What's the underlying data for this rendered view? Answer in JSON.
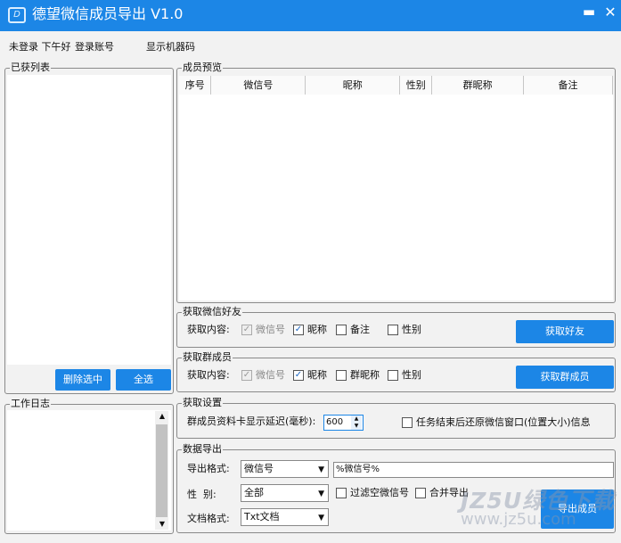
{
  "window": {
    "title": "德望微信成员导出 V1.0",
    "logo_text": "D",
    "minimize_glyph": "▬",
    "close_glyph": "✕",
    "accent_color": "#1c86e6"
  },
  "topbar": {
    "login_status": "未登录 下午好",
    "login_link": "登录账号",
    "machine_code_link": "显示机器码"
  },
  "acquired_list": {
    "legend": "已获列表",
    "delete_selected": "删除选中",
    "select_all": "全选"
  },
  "work_log": {
    "legend": "工作日志"
  },
  "member_preview": {
    "legend": "成员预览",
    "columns": [
      "序号",
      "微信号",
      "昵称",
      "性别",
      "群昵称",
      "备注"
    ]
  },
  "friends": {
    "legend": "获取微信好友",
    "content_label": "获取内容:",
    "options": [
      {
        "label": "微信号",
        "checked": true,
        "disabled": true
      },
      {
        "label": "昵称",
        "checked": true,
        "disabled": false
      },
      {
        "label": "备注",
        "checked": false,
        "disabled": false
      },
      {
        "label": "性别",
        "checked": false,
        "disabled": false
      }
    ],
    "button": "获取好友"
  },
  "group": {
    "legend": "获取群成员",
    "content_label": "获取内容:",
    "options": [
      {
        "label": "微信号",
        "checked": true,
        "disabled": true
      },
      {
        "label": "昵称",
        "checked": true,
        "disabled": false
      },
      {
        "label": "群昵称",
        "checked": false,
        "disabled": false
      },
      {
        "label": "性别",
        "checked": false,
        "disabled": false
      }
    ],
    "button": "获取群成员"
  },
  "settings": {
    "legend": "获取设置",
    "delay_label": "群成员资料卡显示延迟(毫秒):",
    "delay_value": "600",
    "restore_label": "任务结束后还原微信窗口(位置大小)信息",
    "restore_checked": false
  },
  "export": {
    "legend": "数据导出",
    "format_label": "导出格式:",
    "format_value": "微信号",
    "format_template": "%微信号%",
    "gender_label": "性  别:",
    "gender_value": "全部",
    "filter_empty_label": "过滤空微信号",
    "merge_label": "合并导出",
    "doc_format_label": "文档格式:",
    "doc_format_value": "Txt文档",
    "export_button": "导出成员"
  },
  "watermark": {
    "text": "JZ5U绿色下载",
    "url": "www.jz5u.com"
  }
}
